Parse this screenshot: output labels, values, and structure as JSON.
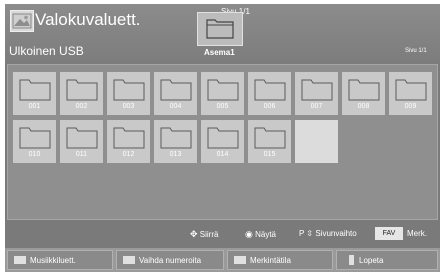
{
  "header": {
    "title": "Valokuvaluett.",
    "page_top": "Sivu 1/1",
    "drive_label": "Asema1",
    "device_label": "Ulkoinen USB",
    "page_right": "Sivu 1/1"
  },
  "folders": [
    "001",
    "002",
    "003",
    "004",
    "005",
    "006",
    "007",
    "008",
    "009",
    "010",
    "011",
    "012",
    "013",
    "014",
    "015"
  ],
  "hints": {
    "move": "Siirrä",
    "view": "Näytä",
    "page": "Sivunvaihto",
    "fav_key": "FAV",
    "mark": "Merk."
  },
  "bottom": {
    "music_list": "Musiikkiluett.",
    "change_numbering": "Vaihda numeroita",
    "mark_mode": "Merkintätila",
    "exit": "Lopeta"
  }
}
